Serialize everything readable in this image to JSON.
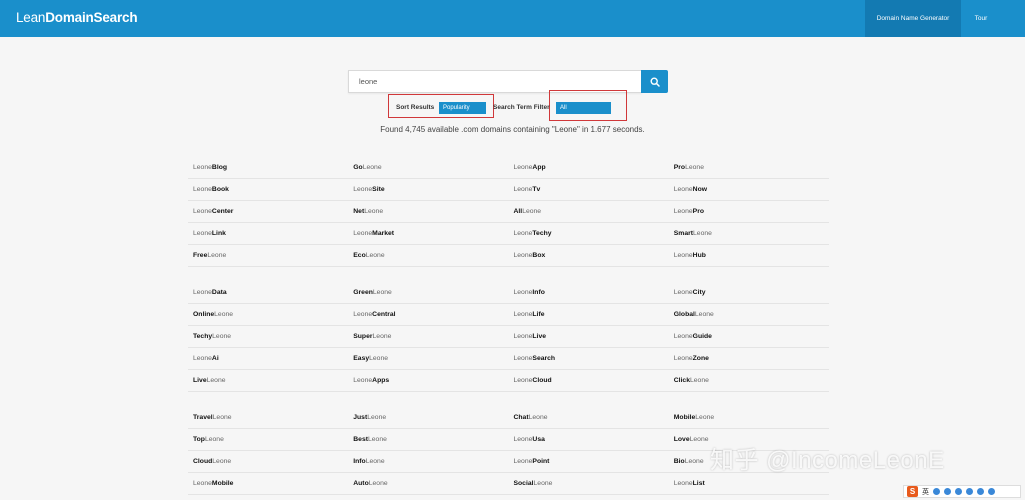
{
  "header": {
    "logo_light": "Lean",
    "logo_bold": "DomainSearch",
    "nav": [
      "Domain Name Generator",
      "Tour"
    ]
  },
  "search": {
    "value": "leone",
    "button_icon": "search-icon"
  },
  "filters": {
    "sort_label": "Sort Results",
    "sort_value": "Popularity",
    "filter_label": "Search Term Filter",
    "filter_value": "All"
  },
  "results_summary": "Found 4,745 available .com domains containing \"Leone\" in 1.677 seconds.",
  "keyword": "Leone",
  "results": [
    [
      [
        "Leone",
        "Blog"
      ],
      [
        "Go",
        "Leone"
      ],
      [
        "Leone",
        "App"
      ],
      [
        "Pro",
        "Leone"
      ],
      [
        "Leone",
        "Book"
      ],
      [
        "Leone",
        "Site"
      ],
      [
        "Leone",
        "Tv"
      ],
      [
        "Leone",
        "Now"
      ],
      [
        "Leone",
        "Center"
      ],
      [
        "Net",
        "Leone"
      ],
      [
        "All",
        "Leone"
      ],
      [
        "Leone",
        "Pro"
      ],
      [
        "Leone",
        "Link"
      ],
      [
        "Leone",
        "Market"
      ],
      [
        "Leone",
        "Techy"
      ],
      [
        "Smart",
        "Leone"
      ],
      [
        "Free",
        "Leone"
      ],
      [
        "Eco",
        "Leone"
      ],
      [
        "Leone",
        "Box"
      ],
      [
        "Leone",
        "Hub"
      ]
    ],
    [
      [
        "Leone",
        "Data"
      ],
      [
        "Green",
        "Leone"
      ],
      [
        "Leone",
        "Info"
      ],
      [
        "Leone",
        "City"
      ],
      [
        "Online",
        "Leone"
      ],
      [
        "Leone",
        "Central"
      ],
      [
        "Leone",
        "Life"
      ],
      [
        "Global",
        "Leone"
      ],
      [
        "Techy",
        "Leone"
      ],
      [
        "Super",
        "Leone"
      ],
      [
        "Leone",
        "Live"
      ],
      [
        "Leone",
        "Guide"
      ],
      [
        "Leone",
        "Ai"
      ],
      [
        "Easy",
        "Leone"
      ],
      [
        "Leone",
        "Search"
      ],
      [
        "Leone",
        "Zone"
      ],
      [
        "Live",
        "Leone"
      ],
      [
        "Leone",
        "Apps"
      ],
      [
        "Leone",
        "Cloud"
      ],
      [
        "Click",
        "Leone"
      ]
    ],
    [
      [
        "Travel",
        "Leone"
      ],
      [
        "Just",
        "Leone"
      ],
      [
        "Chat",
        "Leone"
      ],
      [
        "Mobile",
        "Leone"
      ],
      [
        "Top",
        "Leone"
      ],
      [
        "Best",
        "Leone"
      ],
      [
        "Leone",
        "Usa"
      ],
      [
        "Love",
        "Leone"
      ],
      [
        "Cloud",
        "Leone"
      ],
      [
        "Info",
        "Leone"
      ],
      [
        "Leone",
        "Point"
      ],
      [
        "Bio",
        "Leone"
      ],
      [
        "Leone",
        "Mobile"
      ],
      [
        "Auto",
        "Leone"
      ],
      [
        "Social",
        "Leone"
      ],
      [
        "Leone",
        "List"
      ]
    ]
  ],
  "watermark": "知乎 @IncomeLeonE",
  "ime": {
    "logo": "S",
    "lang": "英"
  }
}
